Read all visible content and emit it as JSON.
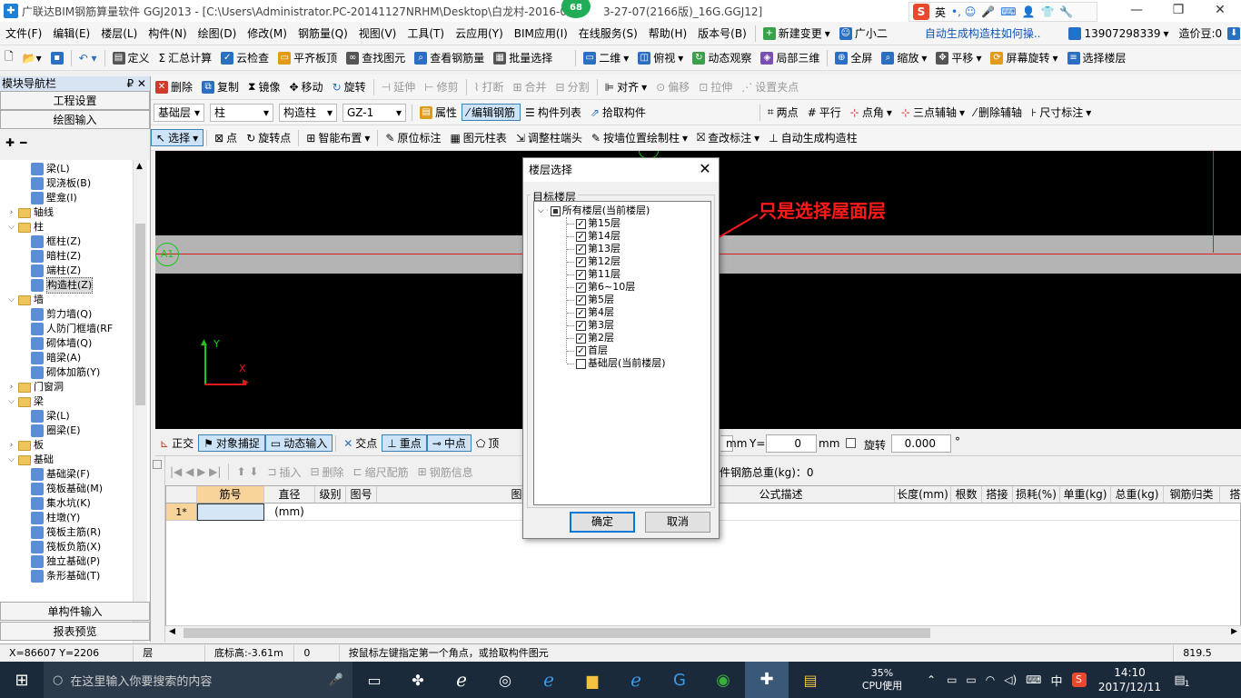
{
  "titlebar": {
    "title": "广联达BIM钢筋算量软件 GGJ2013 - [C:\\Users\\Administrator.PC-20141127NRHM\\Desktop\\白龙村-2016-0",
    "title_tail": "3-27-07(2166版)_16G.GGJ12]",
    "badge": "68",
    "ime_mode": "英",
    "ime_extra": "•, ☺"
  },
  "menubar": {
    "items": [
      "文件(F)",
      "编辑(E)",
      "楼层(L)",
      "构件(N)",
      "绘图(D)",
      "修改(M)",
      "钢筋量(Q)",
      "视图(V)",
      "工具(T)",
      "云应用(Y)",
      "BIM应用(I)",
      "在线服务(S)",
      "帮助(H)",
      "版本号(B)"
    ],
    "new_change": "新建变更",
    "assistant": "广小二",
    "promo": "自动生成构造柱如何操..",
    "phone": "13907298339",
    "points": "造价豆:0"
  },
  "toolbar1": {
    "items": [
      "定义",
      "汇总计算",
      "云检查",
      "平齐板顶",
      "查找图元",
      "查看钢筋量",
      "批量选择"
    ],
    "view_mode": "二维",
    "items2": [
      "俯视",
      "动态观察",
      "局部三维",
      "全屏",
      "缩放",
      "平移",
      "屏幕旋转",
      "选择楼层"
    ]
  },
  "toolbar2": {
    "title": "模块导航栏",
    "items": [
      "删除",
      "复制",
      "镜像",
      "移动",
      "旋转",
      "延伸",
      "修剪",
      "打断",
      "合并",
      "分割",
      "对齐",
      "偏移",
      "拉伸",
      "设置夹点"
    ]
  },
  "toolbar3": {
    "floor": "基础层",
    "category": "柱",
    "type": "构造柱",
    "name": "GZ-1",
    "items": [
      "属性",
      "编辑钢筋",
      "构件列表",
      "拾取构件"
    ],
    "items2": [
      "两点",
      "平行",
      "点角",
      "三点辅轴",
      "删除辅轴",
      "尺寸标注"
    ]
  },
  "toolbar4": {
    "items": [
      "选择",
      "点",
      "旋转点",
      "智能布置",
      "原位标注",
      "图元柱表",
      "调整柱端头",
      "按墙位置绘制柱",
      "查改标注",
      "自动生成构造柱"
    ]
  },
  "leftpanel": {
    "tab1": "工程设置",
    "tab2": "绘图输入",
    "tab3": "单构件输入",
    "tab4": "报表预览",
    "tree": [
      {
        "label": "梁(L)",
        "level": 2,
        "kind": "item"
      },
      {
        "label": "现浇板(B)",
        "level": 2,
        "kind": "item"
      },
      {
        "label": "壁龛(I)",
        "level": 2,
        "kind": "item"
      },
      {
        "label": "轴线",
        "level": 1,
        "kind": "folder",
        "state": "closed"
      },
      {
        "label": "柱",
        "level": 1,
        "kind": "folder",
        "state": "open"
      },
      {
        "label": "框柱(Z)",
        "level": 2,
        "kind": "item"
      },
      {
        "label": "暗柱(Z)",
        "level": 2,
        "kind": "item"
      },
      {
        "label": "端柱(Z)",
        "level": 2,
        "kind": "item"
      },
      {
        "label": "构造柱(Z)",
        "level": 2,
        "kind": "item",
        "selected": true
      },
      {
        "label": "墙",
        "level": 1,
        "kind": "folder",
        "state": "open"
      },
      {
        "label": "剪力墙(Q)",
        "level": 2,
        "kind": "item"
      },
      {
        "label": "人防门框墙(RF",
        "level": 2,
        "kind": "item"
      },
      {
        "label": "砌体墙(Q)",
        "level": 2,
        "kind": "item"
      },
      {
        "label": "暗梁(A)",
        "level": 2,
        "kind": "item"
      },
      {
        "label": "砌体加筋(Y)",
        "level": 2,
        "kind": "item"
      },
      {
        "label": "门窗洞",
        "level": 1,
        "kind": "folder",
        "state": "closed"
      },
      {
        "label": "梁",
        "level": 1,
        "kind": "folder",
        "state": "open"
      },
      {
        "label": "梁(L)",
        "level": 2,
        "kind": "item"
      },
      {
        "label": "圈梁(E)",
        "level": 2,
        "kind": "item"
      },
      {
        "label": "板",
        "level": 1,
        "kind": "folder",
        "state": "closed"
      },
      {
        "label": "基础",
        "level": 1,
        "kind": "folder",
        "state": "open"
      },
      {
        "label": "基础梁(F)",
        "level": 2,
        "kind": "item"
      },
      {
        "label": "筏板基础(M)",
        "level": 2,
        "kind": "item"
      },
      {
        "label": "集水坑(K)",
        "level": 2,
        "kind": "item"
      },
      {
        "label": "柱墩(Y)",
        "level": 2,
        "kind": "item"
      },
      {
        "label": "筏板主筋(R)",
        "level": 2,
        "kind": "item"
      },
      {
        "label": "筏板负筋(X)",
        "level": 2,
        "kind": "item"
      },
      {
        "label": "独立基础(P)",
        "level": 2,
        "kind": "item"
      },
      {
        "label": "条形基础(T)",
        "level": 2,
        "kind": "item"
      }
    ]
  },
  "canvas": {
    "axis_label": "A1",
    "y_axis": "Y",
    "x_axis": "X",
    "annotation": "只是选择屋面层"
  },
  "snapbar": {
    "items": [
      "正交",
      "对象捕捉",
      "动态输入",
      "交点",
      "重点",
      "中点",
      "顶"
    ],
    "unit": "mm",
    "y_label": "Y=",
    "y_value": "0",
    "unit2": "mm",
    "rotate_label": "旋转",
    "rotate_value": "0.000",
    "degree": "°"
  },
  "grid": {
    "toolbar": [
      "插入",
      "删除",
      "缩尺配筋",
      "钢筋信息"
    ],
    "total": "件钢筋总重(kg)：0",
    "headers": [
      "筋号",
      "直径(mm)",
      "级别",
      "图号",
      "图形",
      "公式描述",
      "长度(mm)",
      "根数",
      "搭接",
      "损耗(%)",
      "单重(kg)",
      "总重(kg)",
      "钢筋归类",
      "搭接形"
    ],
    "row_label": "1*"
  },
  "statusbar": {
    "coords": "X=86607 Y=2206",
    "floor_height": "层高:3.58m",
    "bottom_height": "底标高:-3.61m",
    "value": "0",
    "hint": "按鼠标左键指定第一个角点，或拾取构件图元",
    "fps": "819.5 FPS"
  },
  "dialog": {
    "title": "楼层选择",
    "group": "目标楼层",
    "root": "所有楼层(当前楼层)",
    "floors": [
      {
        "label": "第15层",
        "checked": true
      },
      {
        "label": "第14层",
        "checked": true
      },
      {
        "label": "第13层",
        "checked": true
      },
      {
        "label": "第12层",
        "checked": true
      },
      {
        "label": "第11层",
        "checked": true
      },
      {
        "label": "第6~10层",
        "checked": true
      },
      {
        "label": "第5层",
        "checked": true
      },
      {
        "label": "第4层",
        "checked": true
      },
      {
        "label": "第3层",
        "checked": true
      },
      {
        "label": "第2层",
        "checked": true
      },
      {
        "label": "首层",
        "checked": true
      },
      {
        "label": "基础层(当前楼层)",
        "checked": false
      }
    ],
    "ok": "确定",
    "cancel": "取消"
  },
  "taskbar": {
    "search": "在这里输入你要搜索的内容",
    "cpu_pct": "35%",
    "cpu_label": "CPU使用",
    "ime": "中",
    "time": "14:10",
    "date": "2017/12/11",
    "notif": "1"
  },
  "colors": {
    "accent": "#1e7fd6",
    "canvas": "#000000",
    "annotation": "#ff1a1a",
    "axis_y": "#19c919",
    "axis_x": "#e01b1b"
  }
}
